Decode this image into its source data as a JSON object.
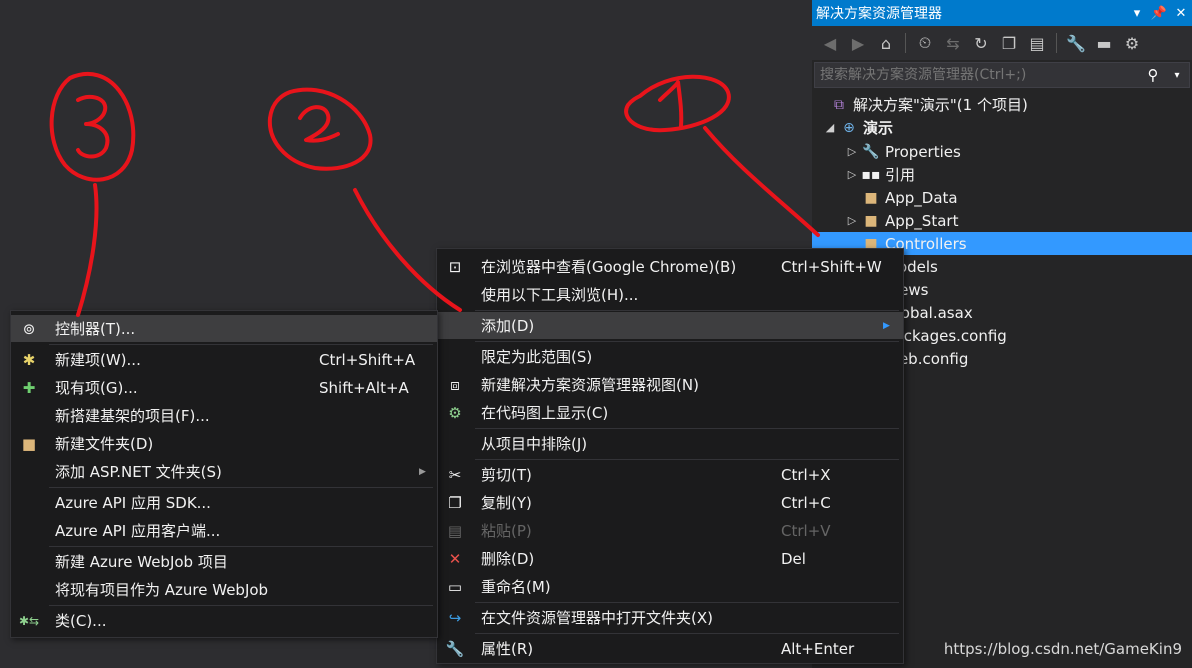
{
  "solution_explorer": {
    "title": "解决方案资源管理器",
    "search_placeholder": "搜索解决方案资源管理器(Ctrl+;)",
    "tree": {
      "solution": "解决方案\"演示\"(1 个项目)",
      "project": "演示",
      "items": [
        "Properties",
        "引用",
        "App_Data",
        "App_Start",
        "Controllers",
        "Models",
        "Views",
        "Global.asax",
        "packages.config",
        "Web.config"
      ]
    }
  },
  "context_menu": {
    "items": [
      {
        "label": "在浏览器中查看(Google Chrome)(B)",
        "shortcut": "Ctrl+Shift+W"
      },
      {
        "label": "使用以下工具浏览(H)..."
      },
      {
        "label": "添加(D)"
      },
      {
        "label": "限定为此范围(S)"
      },
      {
        "label": "新建解决方案资源管理器视图(N)"
      },
      {
        "label": "在代码图上显示(C)"
      },
      {
        "label": "从项目中排除(J)"
      },
      {
        "label": "剪切(T)",
        "shortcut": "Ctrl+X"
      },
      {
        "label": "复制(Y)",
        "shortcut": "Ctrl+C"
      },
      {
        "label": "粘贴(P)",
        "shortcut": "Ctrl+V"
      },
      {
        "label": "删除(D)",
        "shortcut": "Del"
      },
      {
        "label": "重命名(M)"
      },
      {
        "label": "在文件资源管理器中打开文件夹(X)"
      },
      {
        "label": "属性(R)",
        "shortcut": "Alt+Enter"
      }
    ]
  },
  "add_submenu": {
    "items": [
      {
        "label": "控制器(T)..."
      },
      {
        "label": "新建项(W)...",
        "shortcut": "Ctrl+Shift+A"
      },
      {
        "label": "现有项(G)...",
        "shortcut": "Shift+Alt+A"
      },
      {
        "label": "新搭建基架的项目(F)..."
      },
      {
        "label": "新建文件夹(D)"
      },
      {
        "label": "添加 ASP.NET 文件夹(S)"
      },
      {
        "label": "Azure API 应用 SDK..."
      },
      {
        "label": "Azure API 应用客户端..."
      },
      {
        "label": "新建 Azure WebJob 项目"
      },
      {
        "label": "将现有项目作为 Azure WebJob"
      },
      {
        "label": "类(C)..."
      }
    ]
  },
  "watermark": "https://blog.csdn.net/GameKin9",
  "colors": {
    "accent": "#007acc",
    "selection": "#3399ff",
    "annotation": "#e8141b",
    "menu_bg": "#1b1b1c",
    "menu_highlight": "#3e3e40"
  },
  "icons": {
    "pin": "pin-icon",
    "close": "close-icon",
    "search": "search-icon",
    "folder": "folder-icon",
    "wrench": "wrench-icon",
    "cut": "scissors-icon",
    "delete": "delete-x-icon",
    "copy": "copy-icon",
    "paste": "paste-icon"
  }
}
